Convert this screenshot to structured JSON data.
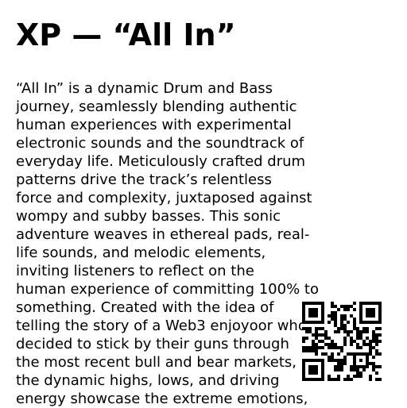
{
  "title": "XP — “All In”",
  "description": {
    "lines": [
      "“All In” is a dynamic Drum and Bass",
      "journey, seamlessly blending authentic",
      "human experiences with experimental",
      "electronic sounds and the soundtrack of",
      "everyday life. Meticulously crafted drum",
      "patterns drive the track’s relentless",
      "force and complexity, juxtaposed against",
      "wompy and subby basses. This sonic",
      "adventure weaves in ethereal pads, real-",
      "life sounds, and melodic elements,",
      "inviting listeners to reflect on the",
      "human experience of committing 100% to",
      "something. Created with the idea of",
      "telling the story of a Web3 enjoyoor who",
      "decided to stick by their guns through",
      "the most recent bull and bear markets,",
      "the dynamic highs, lows, and driving",
      "energy showcase the extreme emotions,"
    ]
  },
  "qr_code": {
    "icon": "qr-code-icon",
    "foreground": "#000000",
    "background": "#ffffff"
  }
}
